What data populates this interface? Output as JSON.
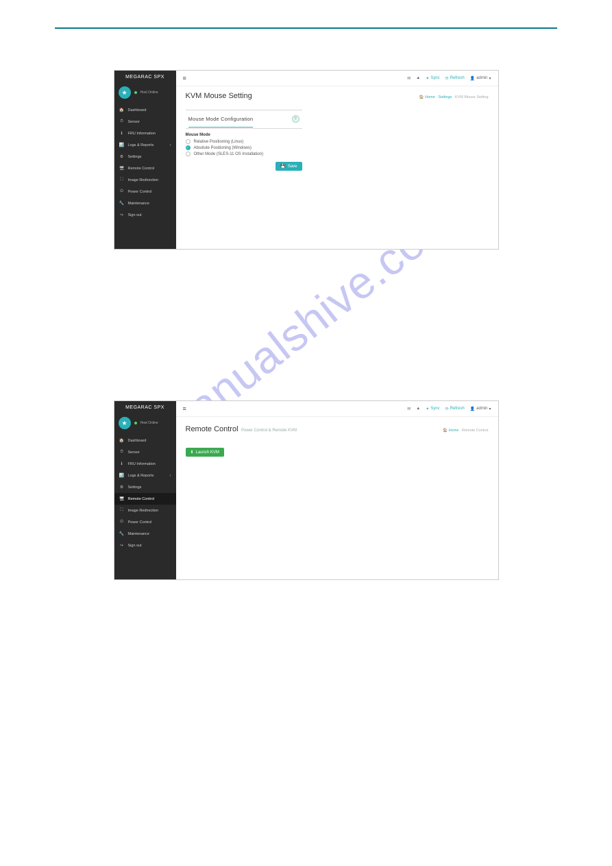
{
  "watermark": "manualshive.com",
  "header": {
    "logo": "MEGARAC SPX",
    "host_status": "Host Online",
    "hamburger": "≡",
    "icons": {
      "mail": "✉",
      "warn": "▲"
    },
    "sync": "Sync",
    "refresh": "Refresh",
    "user": "admin",
    "caret": "▾"
  },
  "menu": [
    {
      "icon": "🏠",
      "label": "Dashboard"
    },
    {
      "icon": "⏱",
      "label": "Sensor"
    },
    {
      "icon": "ℹ",
      "label": "FRU Information"
    },
    {
      "icon": "📊",
      "label": "Logs & Reports",
      "expand": true
    },
    {
      "icon": "⚙",
      "label": "Settings"
    },
    {
      "icon": "🖥",
      "label": "Remote Control"
    },
    {
      "icon": "⛶",
      "label": "Image Redirection"
    },
    {
      "icon": "⏻",
      "label": "Power Control"
    },
    {
      "icon": "🔧",
      "label": "Maintenance"
    },
    {
      "icon": "↪",
      "label": "Sign out"
    }
  ],
  "shot1": {
    "title": "KVM Mouse Setting",
    "crumbs": {
      "home": "Home",
      "mid": "Settings",
      "cur": "KVM Mouse Setting",
      "home_icon": "🏠"
    },
    "card_title": "Mouse Mode Configuration",
    "help": "?",
    "form_label": "Mouse Mode",
    "options": [
      {
        "label": "Relative Positioning (Linux)",
        "checked": false
      },
      {
        "label": "Absolute Positioning (Windows)",
        "checked": true
      },
      {
        "label": "Other Mode (SLES-11 OS Installation)",
        "checked": false
      }
    ],
    "save_icon": "💾",
    "save": "Save"
  },
  "shot2": {
    "title": "Remote Control",
    "subtitle": "Power Control & Remote KVM",
    "crumbs": {
      "home": "Home",
      "cur": "Remote Control",
      "home_icon": "🏠"
    },
    "launch_icon": "⬇",
    "launch": "Launch KVM",
    "active_menu_index": 5
  }
}
